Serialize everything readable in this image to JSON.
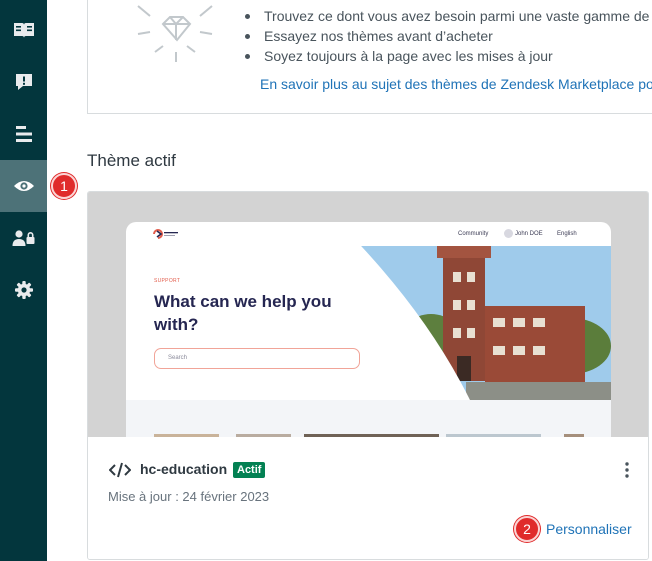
{
  "sidebar": {
    "items": [
      {
        "icon": "guide-book-icon",
        "active": false
      },
      {
        "icon": "feedback-alert-icon",
        "active": false
      },
      {
        "icon": "list-align-icon",
        "active": false
      },
      {
        "icon": "eye-icon",
        "active": true
      },
      {
        "icon": "user-lock-icon",
        "active": false
      },
      {
        "icon": "gear-icon",
        "active": false
      }
    ],
    "active_color": "#4d7278",
    "background": "#03363d"
  },
  "marketplace": {
    "bullets": [
      "Trouvez ce dont vous avez besoin parmi une vaste gamme de",
      "Essayez nos thèmes avant d’acheter",
      "Soyez toujours à la page avec les mises à jour"
    ],
    "link": "En savoir plus au sujet des thèmes de Zendesk Marketplace pou"
  },
  "active_theme": {
    "section_title": "Thème actif",
    "preview": {
      "nav_community": "Community",
      "nav_user": "John DOE",
      "nav_language": "English",
      "support_label": "SUPPORT",
      "headline": "What can we help you with?",
      "search_placeholder": "Search"
    },
    "name": "hc-education",
    "status_badge": "Actif",
    "updated": "Mise à jour : 24 février 2023",
    "customize_label": "Personnaliser"
  },
  "annotations": {
    "step1": "1",
    "step2": "2"
  },
  "colors": {
    "link": "#1f73b7",
    "badge_green": "#038153",
    "annotation_red": "#e02b2b"
  }
}
